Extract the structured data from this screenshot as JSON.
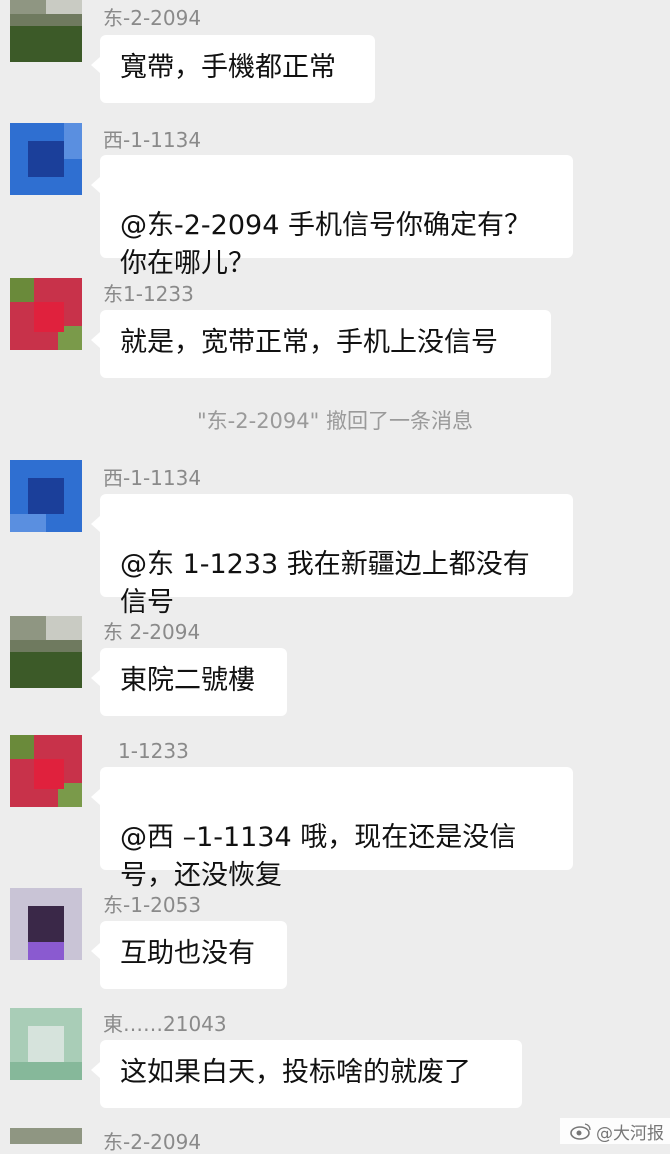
{
  "messages": [
    {
      "sender": "东-2-2094",
      "text": "寬帶，手機都正常",
      "avatar": "green"
    },
    {
      "sender": "西-1-1134",
      "text": "@东-2-2094 手机信号你确定有？\n你在哪儿？",
      "avatar": "blue"
    },
    {
      "sender": "东1-1233",
      "text": "就是，宽带正常，手机上没信号",
      "avatar": "red"
    },
    {
      "sender": "西-1-1134",
      "text": "@东 1-1233 我在新疆边上都没有\n信号",
      "avatar": "blue"
    },
    {
      "sender": "东 2-2094",
      "text": "東院二號樓",
      "avatar": "green"
    },
    {
      "sender": "1-1233",
      "text": "@西 –1-1134 哦，现在还是没信\n号，还没恢复",
      "avatar": "red"
    },
    {
      "sender": "东-1-2053",
      "text": "互助也没有",
      "avatar": "purple"
    },
    {
      "sender": "東……21043",
      "text": "这如果白天，投标啥的就废了",
      "avatar": "teal"
    }
  ],
  "partial_sender": "东-2-2094",
  "recall_notice": "\"东-2-2094\" 撤回了一条消息",
  "watermark": "@大河报",
  "colors": {
    "background": "#ededed",
    "bubble": "#ffffff",
    "name": "#8a8a8a"
  }
}
